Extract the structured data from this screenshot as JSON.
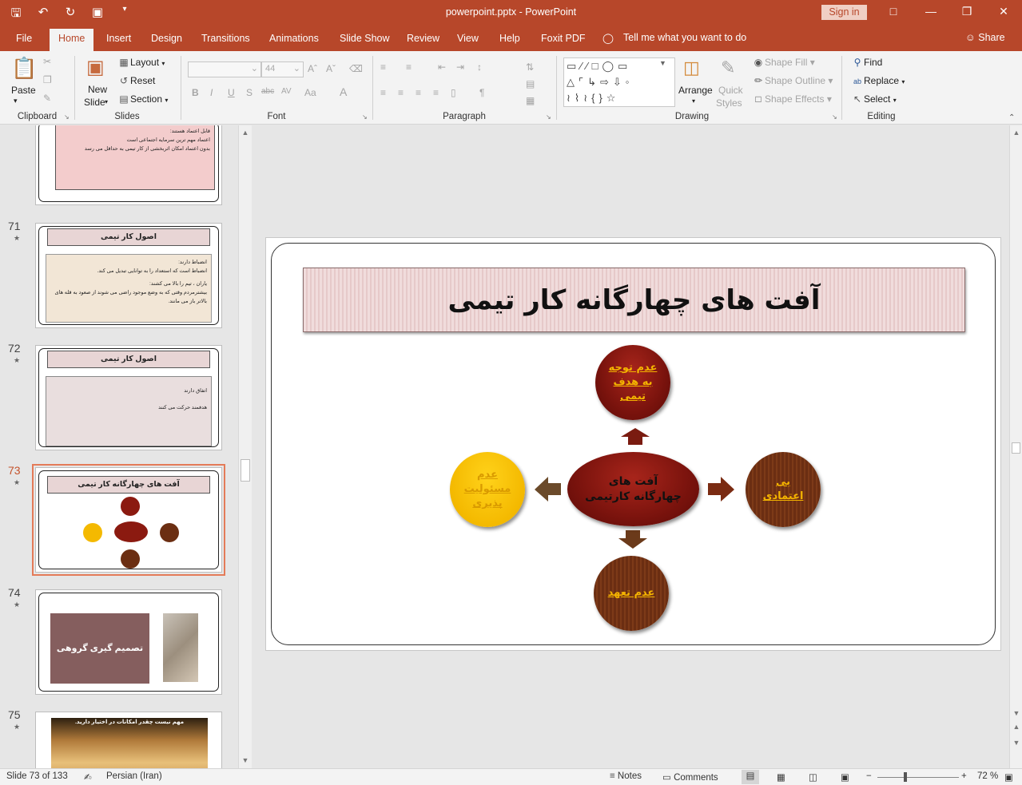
{
  "window": {
    "title": "powerpoint.pptx  -  PowerPoint",
    "signin": "Sign in"
  },
  "tabs": [
    "File",
    "Home",
    "Insert",
    "Design",
    "Transitions",
    "Animations",
    "Slide Show",
    "Review",
    "View",
    "Help",
    "Foxit PDF"
  ],
  "tellme": "Tell me what you want to do",
  "share": "Share",
  "ribbon": {
    "clipboard": {
      "label": "Clipboard",
      "paste": "Paste"
    },
    "slides": {
      "label": "Slides",
      "new_slide_1": "New",
      "new_slide_2": "Slide",
      "layout": "Layout",
      "reset": "Reset",
      "section": "Section"
    },
    "font": {
      "label": "Font",
      "size": "44"
    },
    "paragraph": {
      "label": "Paragraph"
    },
    "drawing": {
      "label": "Drawing",
      "arrange": "Arrange",
      "quick1": "Quick",
      "quick2": "Styles",
      "shape_fill": "Shape Fill",
      "shape_outline": "Shape Outline",
      "shape_effects": "Shape Effects"
    },
    "editing": {
      "label": "Editing",
      "find": "Find",
      "replace": "Replace",
      "select": "Select"
    }
  },
  "thumbnails": {
    "s70": {
      "lines": [
        "قابل اعتماد هستند:",
        "اعتماد مهم ترین سرمایه اجتماعی است",
        "بدون اعتماد امکان اثربخشی از کار تیمی به حداقل می رسد"
      ]
    },
    "s71": {
      "num": "71",
      "title": "اصول کار تیمی",
      "lines": [
        "انضباط دارند:",
        "انضباط است که استعداد را به توانایی تبدیل می کند.",
        "یاران ، تیم را بالا می کشند:",
        "بیشترمردم وقتی که به وضع موجود راضی می شوند از صعود به قله های بالاتر باز می مانند."
      ]
    },
    "s72": {
      "num": "72",
      "title": "اصول کار تیمی",
      "lines": [
        "اتفاق دارند",
        "هدفمند حرکت می کنند"
      ]
    },
    "s73": {
      "num": "73",
      "title": "آفت های چهارگانه کار تیمی"
    },
    "s74": {
      "num": "74",
      "box": "تصمیم گیری گروهی"
    },
    "s75": {
      "num": "75",
      "caption": "مهم نیست چقدر امکانات در اختیار دارید."
    }
  },
  "slide": {
    "title": "آفت های چهارگانه کار تیمی",
    "center_1": "آفت های",
    "center_2": "چهارگانه کارتیمی",
    "top": [
      "عدم توجه",
      "به هدف",
      "تیمی"
    ],
    "right": [
      "بی",
      "اعتمادی"
    ],
    "left": [
      "عدم",
      "مسئولیت",
      "پذیری"
    ],
    "bottom": "عدم تعهد"
  },
  "status": {
    "slide": "Slide 73 of 133",
    "language": "Persian (Iran)",
    "notes": "Notes",
    "comments": "Comments",
    "zoom": "72 %"
  },
  "colors": {
    "accent": "#b7472a",
    "selection": "#e47b58"
  }
}
